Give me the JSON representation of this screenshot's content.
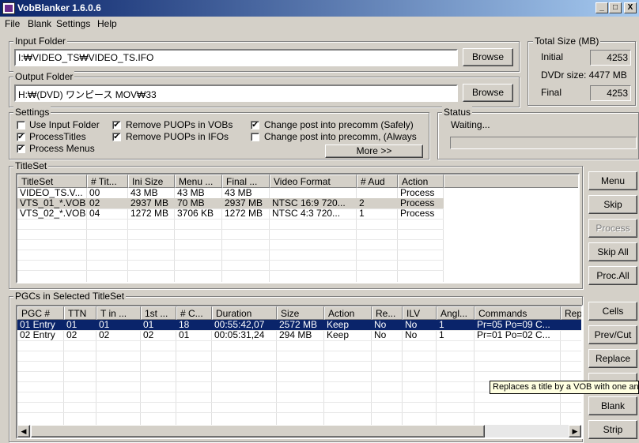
{
  "window": {
    "title": "VobBlanker 1.6.0.6",
    "minimize": "_",
    "maximize": "□",
    "close": "X"
  },
  "menu": [
    "File",
    "Blank",
    "Settings",
    "Help"
  ],
  "input_folder": {
    "label": "Input Folder",
    "value": "I:₩VIDEO_TS₩VIDEO_TS.IFO",
    "browse": "Browse"
  },
  "output_folder": {
    "label": "Output Folder",
    "value": "H:₩(DVD) ワンピース MOV₩33",
    "browse": "Browse"
  },
  "total_size": {
    "label": "Total Size (MB)",
    "initial_label": "Initial",
    "initial_value": "4253",
    "dvdr_label": "DVDr size: 4477 MB",
    "final_label": "Final",
    "final_value": "4253"
  },
  "settings": {
    "label": "Settings",
    "options": [
      {
        "label": "Use Input Folder",
        "checked": false
      },
      {
        "label": "ProcessTitles",
        "checked": true
      },
      {
        "label": "Process Menus",
        "checked": true
      },
      {
        "label": "Remove PUOPs in VOBs",
        "checked": true
      },
      {
        "label": "Remove PUOPs in IFOs",
        "checked": true
      },
      {
        "label": "Change post into precomm (Safely)",
        "checked": true
      },
      {
        "label": "Change post into precomm, (Always",
        "checked": false
      }
    ],
    "more_button": "More >>"
  },
  "status": {
    "label": "Status",
    "text": "Waiting...",
    "progress": 0
  },
  "titleset": {
    "label": "TitleSet",
    "columns": [
      "TitleSet",
      "# Tit...",
      "Ini Size",
      "Menu ...",
      "Final ...",
      "Video Format",
      "# Aud",
      "Action"
    ],
    "rows": [
      [
        "VIDEO_TS.V...",
        "00",
        "43 MB",
        "43 MB",
        "43 MB",
        "",
        "",
        "Process"
      ],
      [
        "VTS_01_*.VOB",
        "02",
        "2937 MB",
        "70 MB",
        "2937 MB",
        "NTSC  16:9 720...",
        "2",
        "Process"
      ],
      [
        "VTS_02_*.VOB",
        "04",
        "1272 MB",
        "3706 KB",
        "1272 MB",
        "NTSC   4:3 720...",
        "1",
        "Process"
      ]
    ],
    "buttons": [
      "Menu",
      "Skip",
      "Process",
      "Skip All",
      "Proc.All"
    ]
  },
  "pgcs": {
    "label": "PGCs in Selected TitleSet",
    "columns": [
      "PGC #",
      "TTN",
      "T in ...",
      "1st ...",
      "# C...",
      "Duration",
      "Size",
      "Action",
      "Re...",
      "ILV",
      "Angl...",
      "Commands",
      "Rep"
    ],
    "rows": [
      [
        "01 Entry",
        "01",
        "01",
        "01",
        "18",
        "00:55:42,07",
        "2572 MB",
        "Keep",
        "No",
        "No",
        "1",
        "Pr=05 Po=09 C...",
        ""
      ],
      [
        "02 Entry",
        "02",
        "02",
        "02",
        "01",
        "00:05:31,24",
        "294 MB",
        "Keep",
        "No",
        "No",
        "1",
        "Pr=01 Po=02 C...",
        ""
      ]
    ],
    "buttons": [
      "Cells",
      "Prev/Cut",
      "Replace",
      "Blank",
      "Strip"
    ]
  },
  "tooltip": "Replaces a title by a VOB with one and"
}
